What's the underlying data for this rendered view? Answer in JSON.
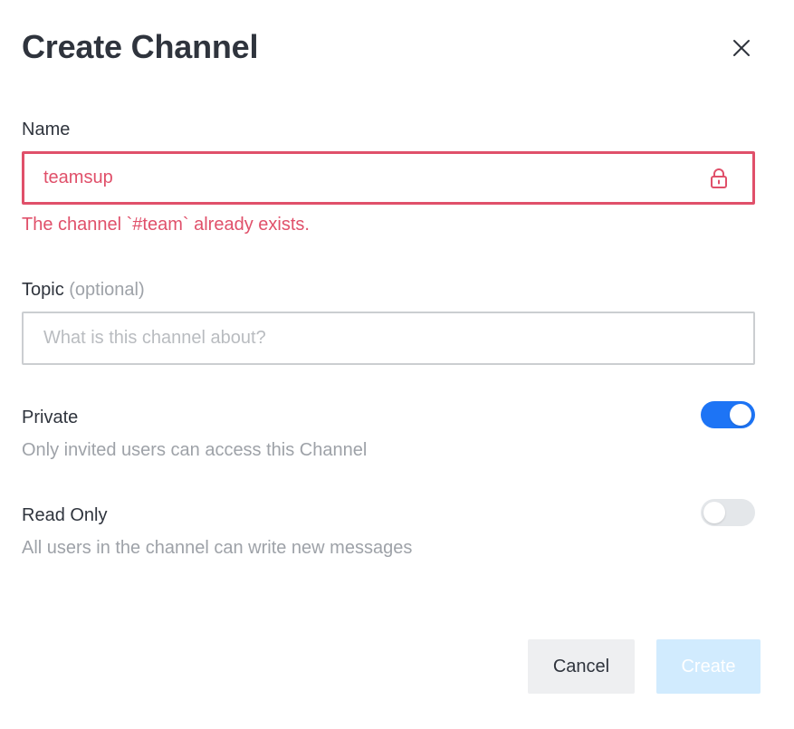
{
  "modal": {
    "title": "Create Channel",
    "close_icon": "close-icon"
  },
  "name_field": {
    "label": "Name",
    "value": "teamsup",
    "icon": "lock-icon",
    "error": "The channel `#team` already exists."
  },
  "topic_field": {
    "label": "Topic",
    "optional_label": "(optional)",
    "value": "",
    "placeholder": "What is this channel about?"
  },
  "private_toggle": {
    "label": "Private",
    "description": "Only invited users can access this Channel",
    "checked": true
  },
  "read_only_toggle": {
    "label": "Read Only",
    "description": "All users in the channel can write new messages",
    "checked": false
  },
  "actions": {
    "cancel_label": "Cancel",
    "create_label": "Create",
    "create_disabled": true
  },
  "colors": {
    "error": "#e0506a",
    "accent": "#1d74f5",
    "create_disabled_bg": "#d1ebfe",
    "cancel_bg": "#eeeff1"
  }
}
